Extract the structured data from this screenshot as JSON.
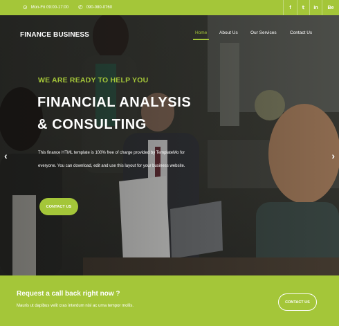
{
  "topbar": {
    "hours": "Mon-Fri 09:00-17:00",
    "phone": "090-080-0760",
    "social": [
      {
        "icon": "facebook-icon",
        "label": "f"
      },
      {
        "icon": "twitter-icon",
        "label": "𝕥"
      },
      {
        "icon": "linkedin-icon",
        "label": "in"
      },
      {
        "icon": "behance-icon",
        "label": "Be"
      }
    ]
  },
  "header": {
    "brand": "FINANCE BUSINESS",
    "nav": [
      "Home",
      "About Us",
      "Our Services",
      "Contact Us"
    ]
  },
  "hero": {
    "tagline": "WE ARE READY TO HELP YOU",
    "headline_line1": "FINANCIAL ANALYSIS",
    "headline_line2": "& CONSULTING",
    "description": "This finance HTML template is 100% free of charge provided by TemplateMo for everyone. You can download, edit and use this layout for your business website.",
    "cta_label": "CONTACT US",
    "prev_label": "‹",
    "next_label": "›"
  },
  "callback": {
    "title": "Request a call back right now ?",
    "subtitle": "Mauris ut dapibus velit cras interdum nisl ac urna tempor mollis.",
    "button_label": "CONTACT US"
  },
  "colors": {
    "accent": "#a4c639",
    "text_light": "#ffffff"
  }
}
